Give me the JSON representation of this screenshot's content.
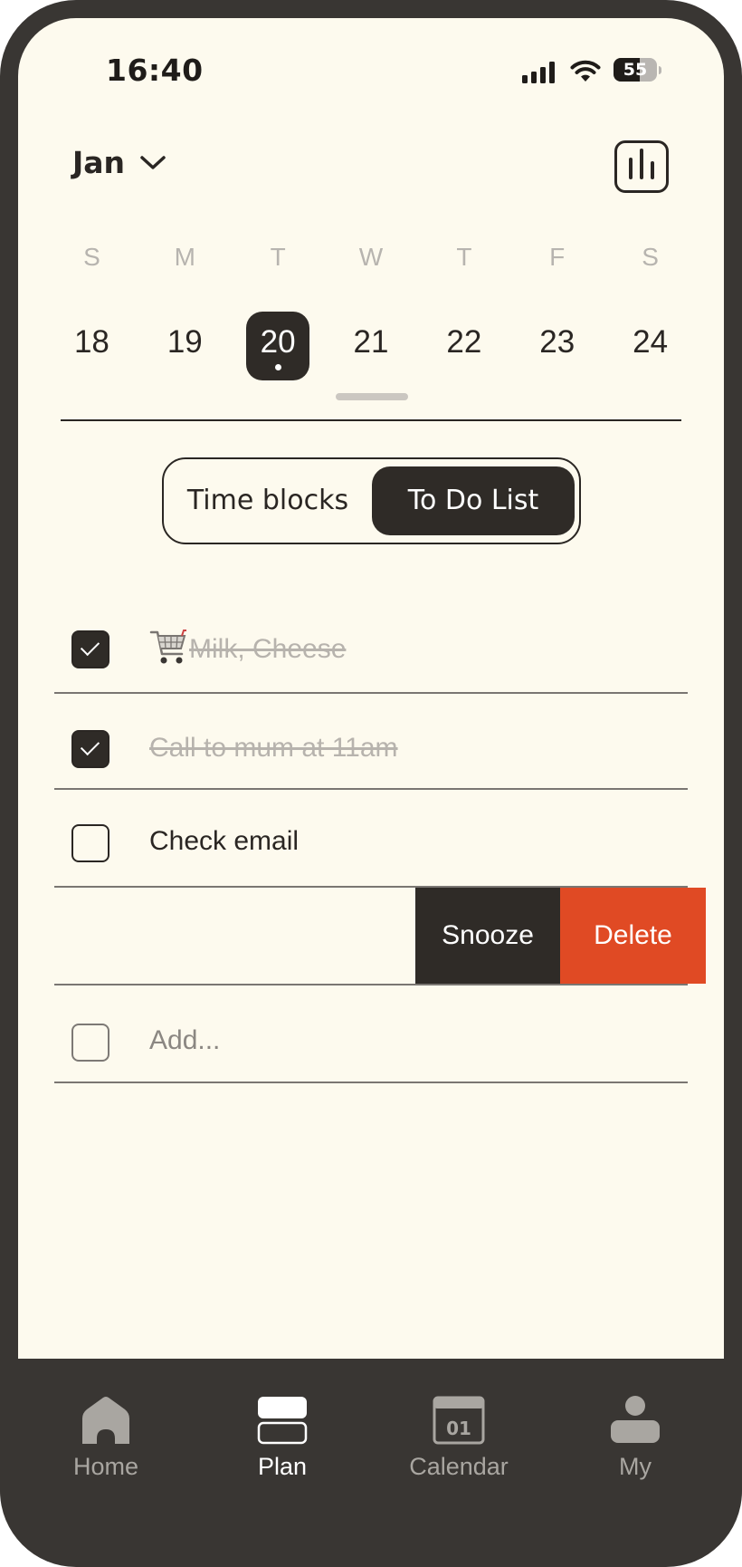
{
  "status_bar": {
    "time": "16:40",
    "battery": "55"
  },
  "header": {
    "month": "Jan"
  },
  "week": {
    "days": [
      "S",
      "M",
      "T",
      "W",
      "T",
      "F",
      "S"
    ],
    "dates": [
      "18",
      "19",
      "20",
      "21",
      "22",
      "23",
      "24"
    ],
    "selected_date": "20"
  },
  "view_toggle": {
    "left": "Time blocks",
    "right": "To Do List",
    "active": "To Do List"
  },
  "todos": [
    {
      "text": "Milk, Cheese",
      "icon": "shopping-cart-icon",
      "done": true
    },
    {
      "text": "Call to mum at 11am",
      "done": true
    },
    {
      "text": "Check email",
      "done": false
    }
  ],
  "swipe_actions": {
    "snooze": "Snooze",
    "delete": "Delete"
  },
  "add_placeholder": "Add...",
  "tabs": [
    {
      "label": "Home",
      "icon": "home-icon"
    },
    {
      "label": "Plan",
      "icon": "plan-icon",
      "active": true
    },
    {
      "label": "Calendar",
      "icon": "calendar-icon",
      "icon_text": "01"
    },
    {
      "label": "My",
      "icon": "person-icon"
    }
  ],
  "colors": {
    "background": "#fdfaee",
    "dark": "#2f2b27",
    "frame": "#393633",
    "delete": "#e04a24",
    "muted": "#b7b3ad"
  }
}
